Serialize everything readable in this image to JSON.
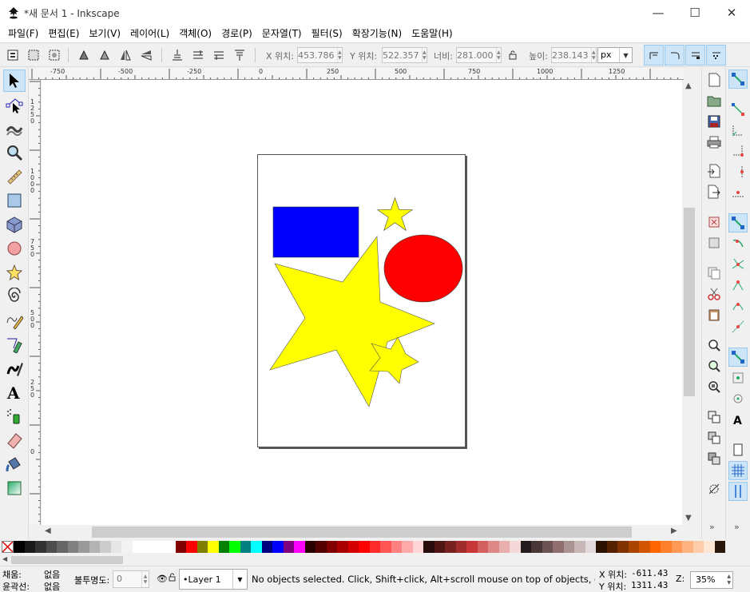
{
  "window": {
    "title": "*새 문서 1 - Inkscape",
    "minimize": "—",
    "maximize": "☐",
    "close": "✕"
  },
  "menu": [
    "파일(F)",
    "편집(E)",
    "보기(V)",
    "레이어(L)",
    "객체(O)",
    "경로(P)",
    "문자열(T)",
    "필터(S)",
    "확장기능(N)",
    "도움말(H)"
  ],
  "toolctl": {
    "x_label": "X 위치:",
    "x_value": "453.786",
    "y_label": "Y 위치:",
    "y_value": "522.357",
    "w_label": "너비:",
    "w_value": "281.000",
    "h_label": "높이:",
    "h_value": "238.143",
    "unit": "px"
  },
  "rulers": {
    "h_labels": [
      "-750",
      "-500",
      "-250",
      "0",
      "250",
      "500",
      "750",
      "1000",
      "1250"
    ],
    "v_labels": [
      "1250",
      "1000",
      "750",
      "500",
      "250",
      "0"
    ]
  },
  "shapes": [
    {
      "type": "rect",
      "fill": "#0000ff"
    },
    {
      "type": "star-small",
      "fill": "#ffff00"
    },
    {
      "type": "ellipse",
      "fill": "#ff0000"
    },
    {
      "type": "star-large",
      "fill": "#ffff00"
    },
    {
      "type": "star-medium",
      "fill": "#ffff00"
    }
  ],
  "palette": [
    "#000000",
    "#1a1a1a",
    "#333333",
    "#4d4d4d",
    "#666666",
    "#808080",
    "#999999",
    "#b3b3b3",
    "#cccccc",
    "#e6e6e6",
    "#f2f2f2",
    "#ffffff",
    "#ffffff",
    "#ffffff",
    "#ffffff",
    "#800000",
    "#ff0000",
    "#808000",
    "#ffff00",
    "#008000",
    "#00ff00",
    "#008080",
    "#00ffff",
    "#000080",
    "#0000ff",
    "#800080",
    "#ff00ff",
    "#2b0000",
    "#550000",
    "#800000",
    "#aa0000",
    "#d40000",
    "#ff0000",
    "#ff2a2a",
    "#ff5555",
    "#ff8080",
    "#ffaaaa",
    "#ffd5d5",
    "#280b0b",
    "#501616",
    "#782121",
    "#a02c2c",
    "#c83737",
    "#d35f5f",
    "#de8787",
    "#e9afaf",
    "#f4d7d7",
    "#241c1c",
    "#483737",
    "#6c5353",
    "#916f6f",
    "#ac9393",
    "#c8b7b7",
    "#e3dbdb",
    "#2b1100",
    "#552200",
    "#803300",
    "#aa4400",
    "#d45500",
    "#ff6600",
    "#ff7f2a",
    "#ff9955",
    "#ffb380",
    "#ffccaa",
    "#ffe6d5",
    "#28170b"
  ],
  "status": {
    "fill_label": "채움:",
    "fill_value": "없음",
    "stroke_label": "윤곽선:",
    "stroke_value": "없음",
    "opacity_label": "불투명도:",
    "opacity_value": "0",
    "layer": "•Layer 1",
    "message": "No objects selected. Click, Shift+click, Alt+scroll mouse on top of objects, or dr",
    "x_label": "X 위치:",
    "x_value": "-611.43",
    "y_label": "Y 위치:",
    "y_value": "1311.43",
    "zoom_label": "Z:",
    "zoom_value": "35%"
  }
}
